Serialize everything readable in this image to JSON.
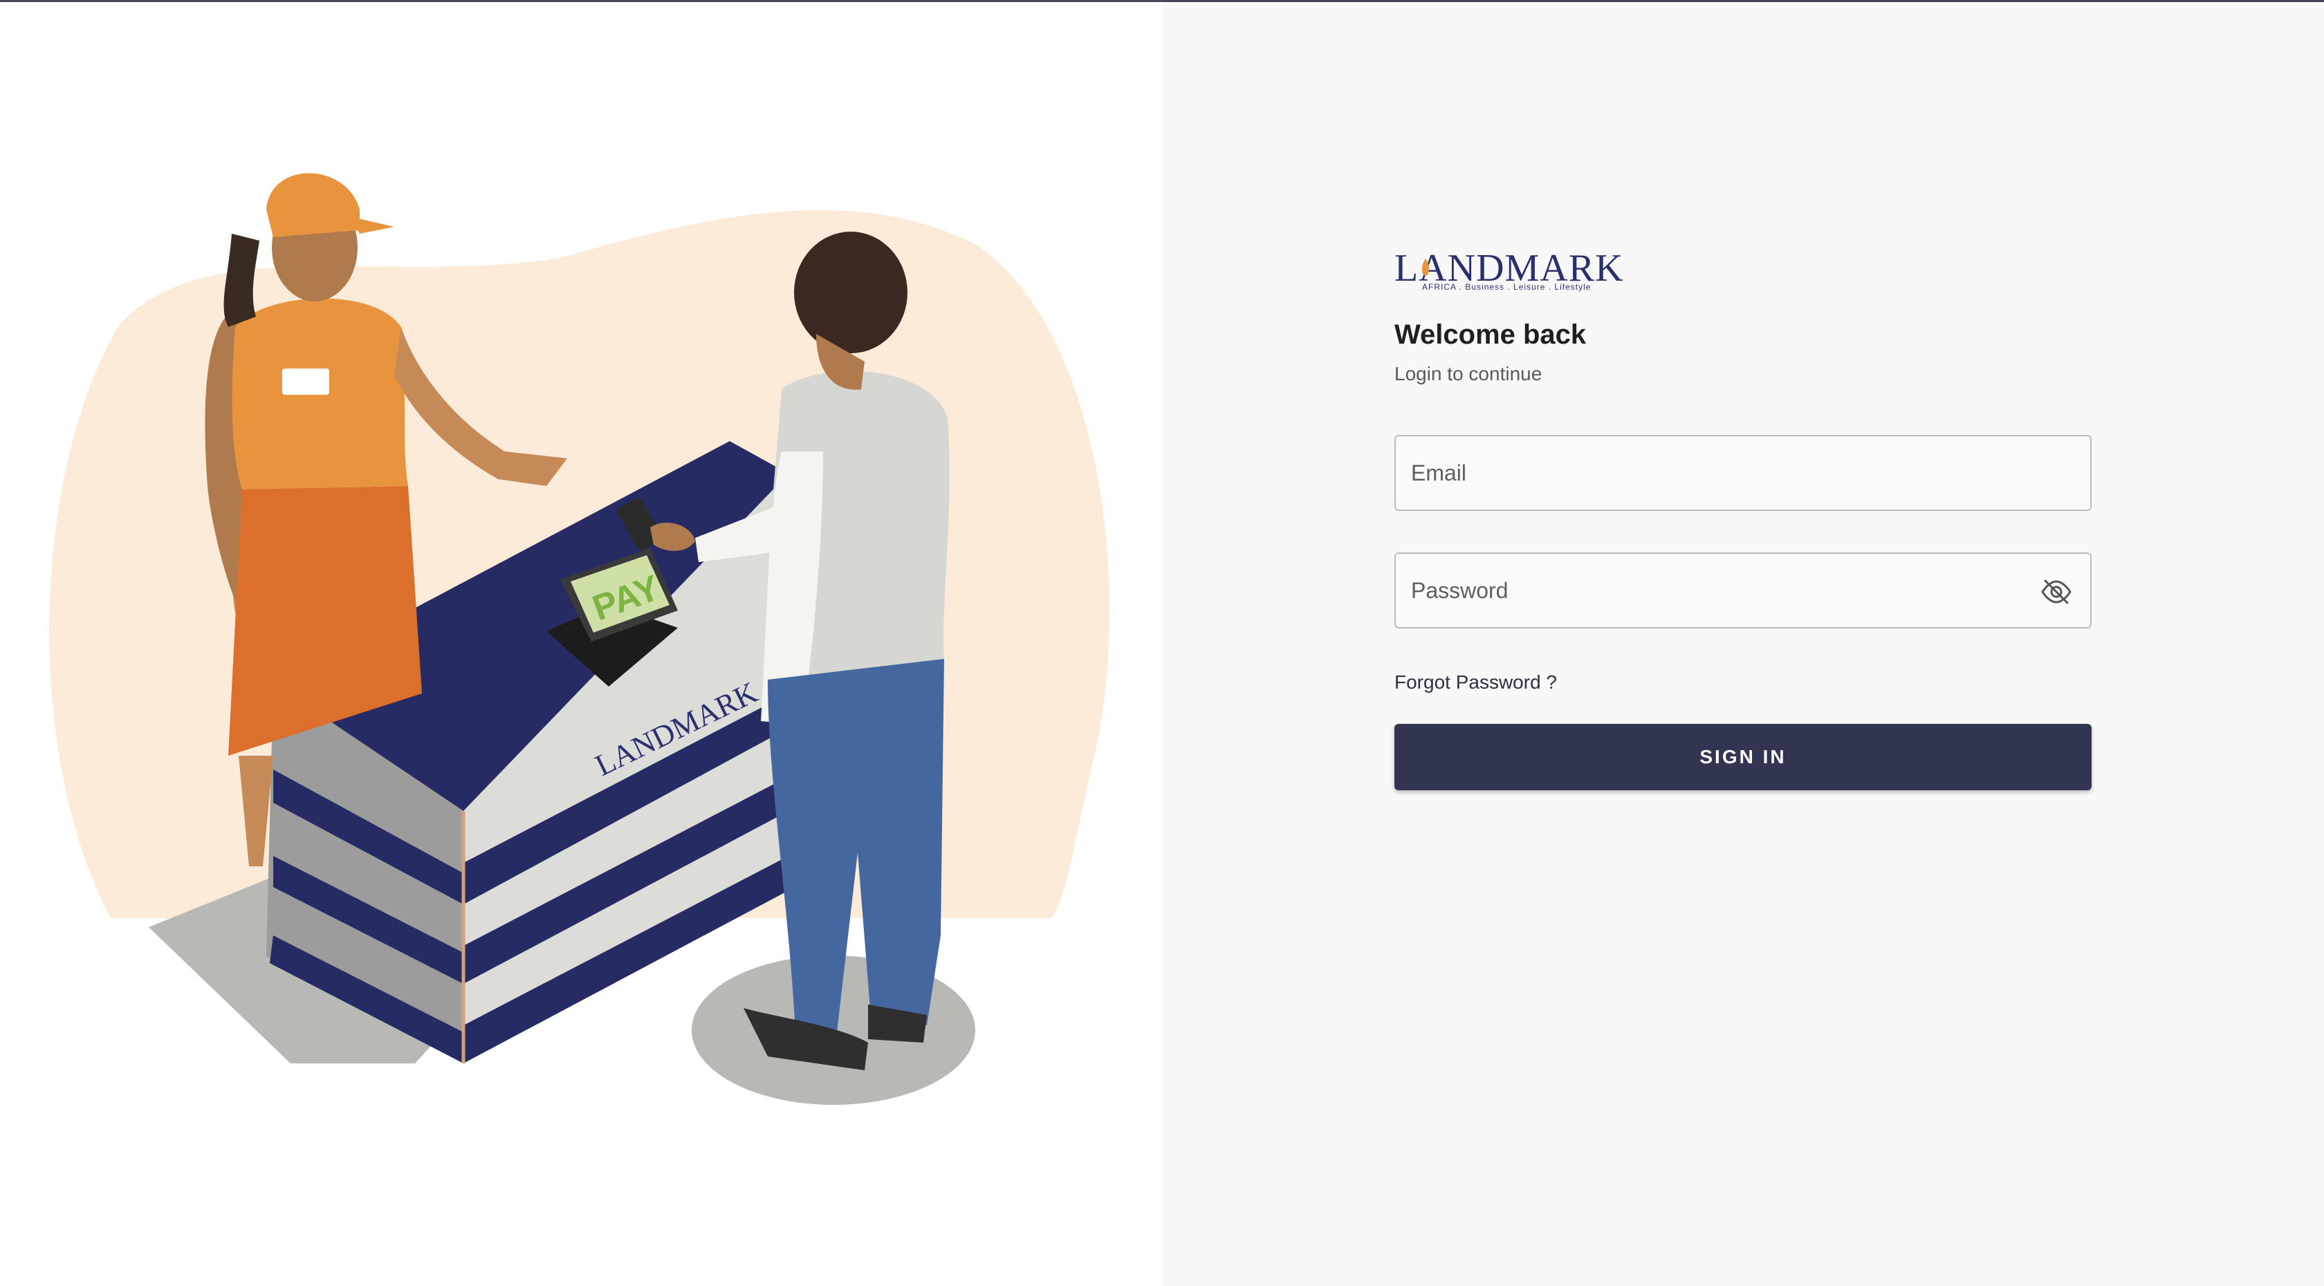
{
  "brand": {
    "logo_text": "LANDMARK",
    "logo_tagline": "AFRICA . Business . Leisure . Lifestyle",
    "primary_color": "#323552",
    "logo_color": "#2a2f6e",
    "accent_color": "#e8943f"
  },
  "illustration": {
    "counter_logo_text": "LANDMARK",
    "terminal_screen_text": "PAY"
  },
  "login": {
    "title": "Welcome back",
    "subtitle": "Login to continue",
    "email_placeholder": "Email",
    "email_value": "",
    "password_placeholder": "Password",
    "password_value": "",
    "password_toggle_icon": "eye-off-icon",
    "forgot_password_label": "Forgot Password ?",
    "submit_label": "SIGN IN"
  }
}
